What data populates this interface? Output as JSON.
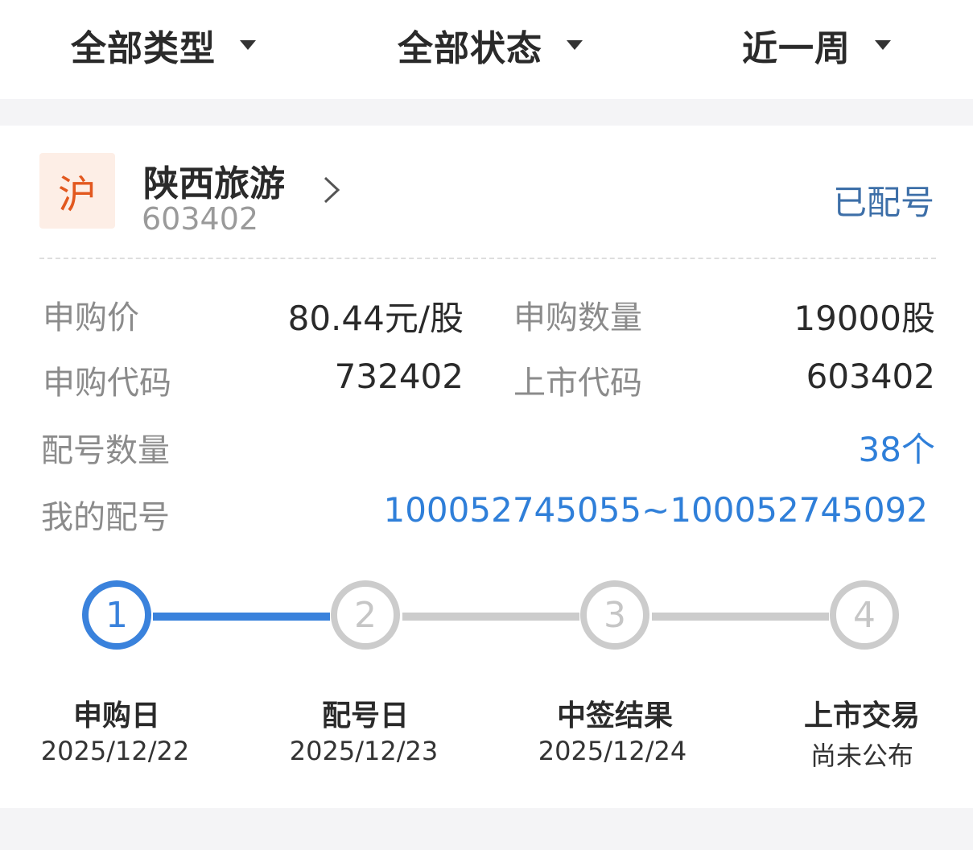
{
  "filters": [
    {
      "label": "全部类型"
    },
    {
      "label": "全部状态"
    },
    {
      "label": "近一周"
    }
  ],
  "stock": {
    "market": "沪",
    "name": "陕西旅游",
    "code": "603402",
    "status": "已配号"
  },
  "details": {
    "price_label": "申购价",
    "price_value": "80.44元/股",
    "qty_label": "申购数量",
    "qty_value": "19000股",
    "sub_code_label": "申购代码",
    "sub_code_value": "732402",
    "list_code_label": "上市代码",
    "list_code_value": "603402",
    "alloc_count_label": "配号数量",
    "alloc_count_value": "38个",
    "my_alloc_label": "我的配号",
    "my_alloc_value": "100052745055~100052745092"
  },
  "steps": [
    {
      "num": "1",
      "title": "申购日",
      "date": "2025/12/22",
      "active": true
    },
    {
      "num": "2",
      "title": "配号日",
      "date": "2025/12/23",
      "active": false
    },
    {
      "num": "3",
      "title": "中签结果",
      "date": "2025/12/24",
      "active": false
    },
    {
      "num": "4",
      "title": "上市交易",
      "date": "尚未公布",
      "active": false
    }
  ],
  "colors": {
    "accent_blue": "#3a82dc",
    "status_blue": "#3d6fa8",
    "market_orange": "#e2581f",
    "inactive_gray": "#cccccc"
  }
}
